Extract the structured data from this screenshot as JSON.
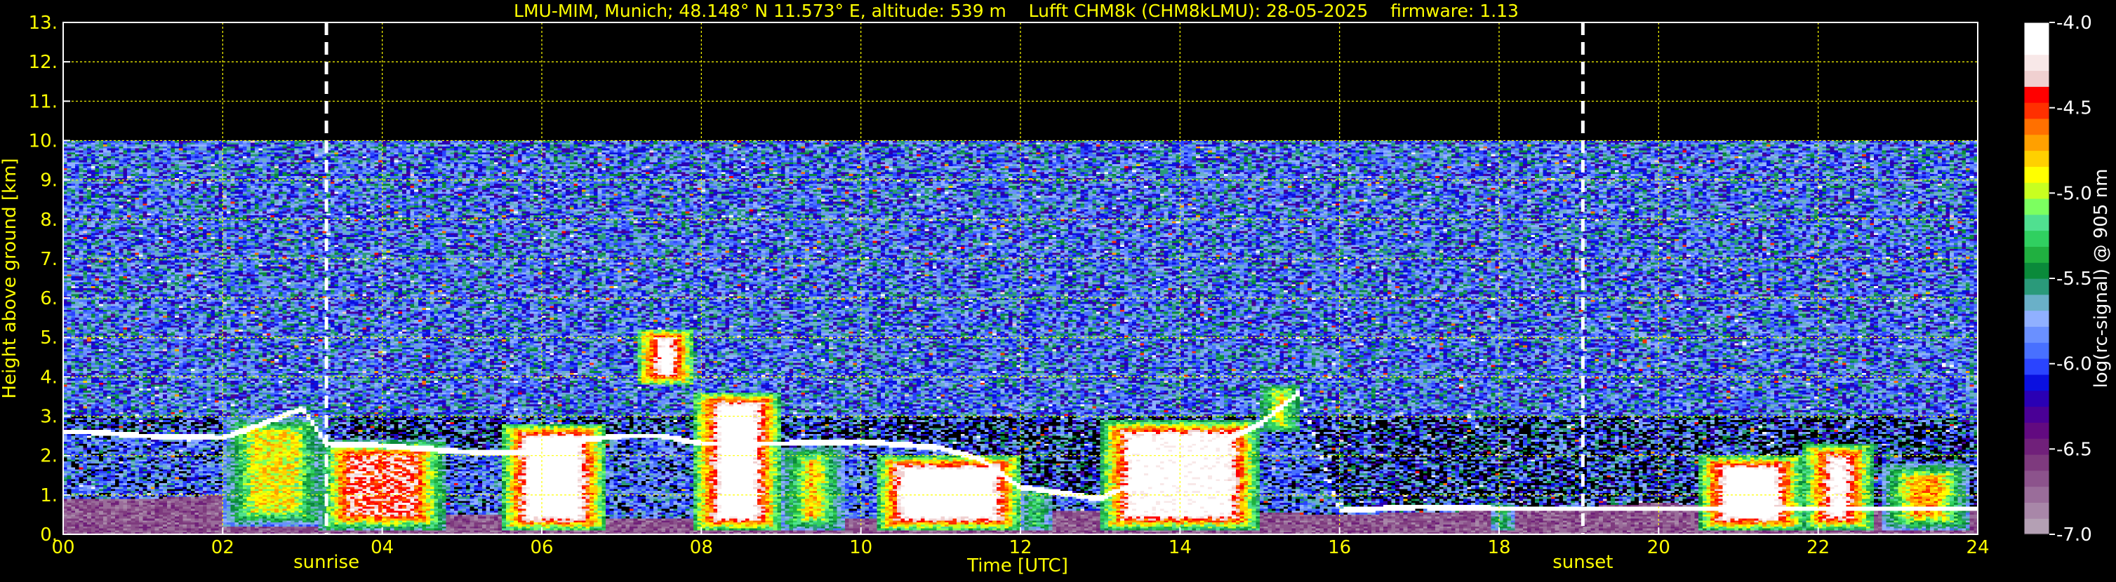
{
  "chart_data": {
    "type": "heatmap",
    "title": "LMU-MIM, Munich; 48.148° N 11.573° E, altitude: 539 m    Lufft CHM8k (CHM8kLMU): 28-05-2025    firmware: 1.13",
    "xlabel": "Time [UTC]",
    "ylabel": "Height above ground [km]",
    "xlim": [
      0,
      24
    ],
    "ylim": [
      0,
      13
    ],
    "x_ticks": [
      "00",
      "02",
      "04",
      "06",
      "08",
      "10",
      "12",
      "14",
      "16",
      "18",
      "20",
      "22",
      "24"
    ],
    "x_tick_values": [
      0,
      2,
      4,
      6,
      8,
      10,
      12,
      14,
      16,
      18,
      20,
      22,
      24
    ],
    "y_ticks": [
      "0.",
      "1.",
      "2.",
      "3.",
      "4.",
      "5.",
      "6.",
      "7.",
      "8.",
      "9.",
      "10.",
      "11.",
      "12.",
      "13."
    ],
    "y_tick_values": [
      0,
      1,
      2,
      3,
      4,
      5,
      6,
      7,
      8,
      9,
      10,
      11,
      12,
      13
    ],
    "grid": true,
    "data_top_km": 10,
    "markers": [
      {
        "label": "sunrise",
        "time": 3.3
      },
      {
        "label": "sunset",
        "time": 19.05
      }
    ],
    "colorbar": {
      "label": "log(rc-signal) @ 905 nm",
      "range": [
        -7.0,
        -4.0
      ],
      "ticks": [
        "-7.0",
        "-6.5",
        "-6.0",
        "-5.5",
        "-5.0",
        "-4.5",
        "-4.0"
      ],
      "tick_values": [
        -7.0,
        -6.5,
        -6.0,
        -5.5,
        -5.0,
        -4.5,
        -4.0
      ],
      "colors": [
        "#b4a0b4",
        "#a887a8",
        "#9a6d9a",
        "#8c538c",
        "#7e3a7e",
        "#70207a",
        "#620a80",
        "#4a0096",
        "#2a00b4",
        "#0a10e0",
        "#2a44ff",
        "#4870ff",
        "#6a90ff",
        "#90b0ff",
        "#6ab0c8",
        "#2a9a7a",
        "#0a8a3a",
        "#20b040",
        "#30d060",
        "#50e090",
        "#7cff60",
        "#c8ff20",
        "#ffff00",
        "#ffd000",
        "#ffa000",
        "#ff7000",
        "#ff3000",
        "#ff0000",
        "#f0d0d0",
        "#f8e8e8",
        "#ffffff",
        "#ffffff"
      ]
    },
    "features": {
      "boundary_layer": [
        [
          0,
          0.9
        ],
        [
          1,
          0.9
        ],
        [
          2,
          1.0
        ],
        [
          3,
          0.8
        ],
        [
          4,
          0.6
        ],
        [
          5,
          0.5
        ],
        [
          6,
          0.5
        ],
        [
          7,
          0.4
        ],
        [
          8,
          0.4
        ],
        [
          10,
          0.4
        ],
        [
          12,
          0.6
        ],
        [
          14,
          0.6
        ],
        [
          16,
          0.5
        ],
        [
          18,
          0.6
        ],
        [
          19,
          0.7
        ],
        [
          20,
          0.8
        ],
        [
          22,
          0.6
        ],
        [
          24,
          0.6
        ]
      ],
      "aerosol_layer_top": [
        [
          0.3,
          2.6
        ],
        [
          1,
          2.5
        ],
        [
          2,
          2.45
        ],
        [
          2.5,
          2.8
        ],
        [
          3,
          3.2
        ],
        [
          3.3,
          2.3
        ],
        [
          4,
          2.25
        ],
        [
          5,
          2.1
        ],
        [
          6,
          2.05
        ],
        [
          6.5,
          2.4
        ],
        [
          7,
          2.5
        ],
        [
          7.5,
          2.5
        ],
        [
          8,
          2.3
        ],
        [
          9,
          2.3
        ],
        [
          10,
          2.35
        ],
        [
          11,
          2.2
        ],
        [
          11.5,
          1.9
        ],
        [
          12,
          1.2
        ],
        [
          13,
          0.9
        ],
        [
          14,
          1.8
        ],
        [
          15,
          2.8
        ],
        [
          15.5,
          3.6
        ],
        [
          16,
          0.6
        ],
        [
          17,
          0.7
        ],
        [
          18,
          0.65
        ]
      ],
      "cloud_patches": [
        {
          "t0": 2.0,
          "t1": 3.3,
          "h0": 0.2,
          "h1": 3.0,
          "i": 0.55
        },
        {
          "t0": 3.2,
          "t1": 4.8,
          "h0": 0.1,
          "h1": 2.4,
          "i": 0.7
        },
        {
          "t0": 5.5,
          "t1": 6.8,
          "h0": 0.1,
          "h1": 2.8,
          "i": 0.85
        },
        {
          "t0": 7.2,
          "t1": 7.9,
          "h0": 3.8,
          "h1": 5.2,
          "i": 0.9
        },
        {
          "t0": 7.9,
          "t1": 9.0,
          "h0": 0.1,
          "h1": 3.6,
          "i": 0.85
        },
        {
          "t0": 9.0,
          "t1": 9.8,
          "h0": 0.1,
          "h1": 2.2,
          "i": 0.6
        },
        {
          "t0": 10.2,
          "t1": 12.0,
          "h0": 0.1,
          "h1": 2.0,
          "i": 0.85
        },
        {
          "t0": 12.0,
          "t1": 12.4,
          "h0": 0.1,
          "h1": 1.2,
          "i": 0.6
        },
        {
          "t0": 13.0,
          "t1": 15.0,
          "h0": 0.1,
          "h1": 2.9,
          "i": 0.8
        },
        {
          "t0": 15.0,
          "t1": 15.5,
          "h0": 2.6,
          "h1": 3.8,
          "i": 0.7
        },
        {
          "t0": 15.6,
          "t1": 15.8,
          "h0": 4.2,
          "h1": 4.8,
          "i": 0.6
        },
        {
          "t0": 17.9,
          "t1": 18.2,
          "h0": 0.1,
          "h1": 0.8,
          "i": 0.6
        },
        {
          "t0": 20.5,
          "t1": 21.8,
          "h0": 0.1,
          "h1": 2.0,
          "i": 0.85
        },
        {
          "t0": 21.8,
          "t1": 22.7,
          "h0": 0.1,
          "h1": 2.3,
          "i": 0.8
        },
        {
          "t0": 22.8,
          "t1": 23.9,
          "h0": 0.1,
          "h1": 1.8,
          "i": 0.6
        }
      ]
    }
  }
}
